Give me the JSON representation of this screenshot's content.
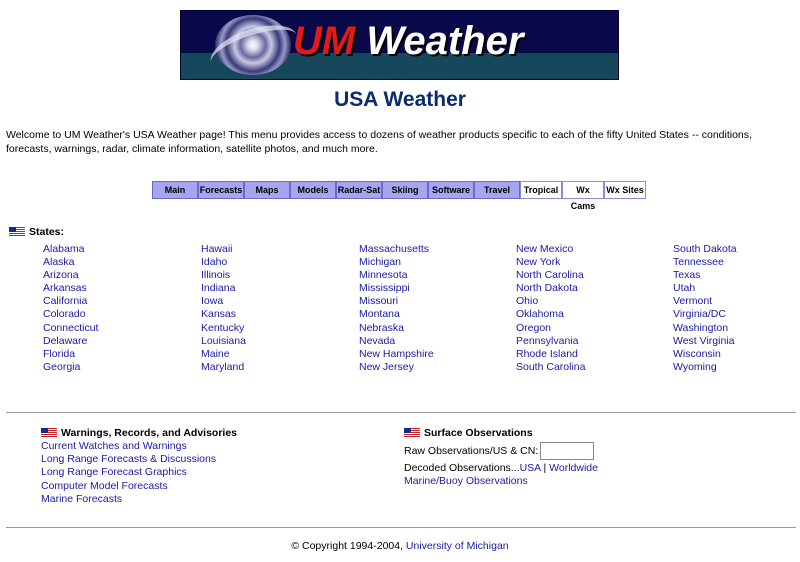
{
  "banner": {
    "brand_um": "UM",
    "brand_weather": "Weather",
    "image": "hurricane-satellite-image"
  },
  "title": "USA Weather",
  "intro": "Welcome to UM Weather's USA Weather page! This menu provides access to dozens of weather products specific to each of the fifty United States -- conditions, forecasts, warnings, radar, climate information, satellite photos, and much more.",
  "nav": [
    {
      "label": "Main",
      "width": 44,
      "style": "active"
    },
    {
      "label": "Forecasts",
      "width": 44,
      "style": "blue"
    },
    {
      "label": "Maps",
      "width": 44,
      "style": "blue"
    },
    {
      "label": "Models",
      "width": 44,
      "style": "blue"
    },
    {
      "label": "Radar-Sat",
      "width": 44,
      "style": "blue"
    },
    {
      "label": "Skiing",
      "width": 44,
      "style": "blue"
    },
    {
      "label": "Software",
      "width": 44,
      "style": "blue"
    },
    {
      "label": "Travel",
      "width": 44,
      "style": "blue"
    },
    {
      "label": "Tropical",
      "width": 40,
      "style": "light"
    },
    {
      "label": "Wx Cams",
      "width": 40,
      "style": "light"
    },
    {
      "label": "Wx Sites",
      "width": 40,
      "style": "light"
    }
  ],
  "states_heading": "States:",
  "states": [
    [
      "Alabama",
      "Alaska",
      "Arizona",
      "Arkansas",
      "California",
      "Colorado",
      "Connecticut",
      "Delaware",
      "Florida",
      "Georgia"
    ],
    [
      "Hawaii",
      "Idaho",
      "Illinois",
      "Indiana",
      "Iowa",
      "Kansas",
      "Kentucky",
      "Louisiana",
      "Maine",
      "Maryland"
    ],
    [
      "Massachusetts",
      "Michigan",
      "Minnesota",
      "Mississippi",
      "Missouri",
      "Montana",
      "Nebraska",
      "Nevada",
      "New Hampshire",
      "New Jersey"
    ],
    [
      "New Mexico",
      "New York",
      "North Carolina",
      "North Dakota",
      "Ohio",
      "Oklahoma",
      "Oregon",
      "Pennsylvania",
      "Rhode Island",
      "South Carolina"
    ],
    [
      "South Dakota",
      "Tennessee",
      "Texas",
      "Utah",
      "Vermont",
      "Virginia/DC",
      "Washington",
      "West Virginia",
      "Wisconsin",
      "Wyoming"
    ]
  ],
  "warnings": {
    "heading": "Warnings, Records, and Advisories",
    "links": [
      "Current Watches and Warnings",
      "Long Range Forecasts & Discussions",
      "Long Range Forecast Graphics",
      "Computer Model Forecasts",
      "Marine Forecasts"
    ]
  },
  "surface": {
    "heading": "Surface Observations",
    "raw_label": "Raw Observations/US & CN:",
    "raw_value": "",
    "decoded_label": "Decoded Observations...",
    "decoded_usa": "USA",
    "decoded_sep": " | ",
    "decoded_world": "Worldwide",
    "marine": "Marine/Buoy Observations"
  },
  "footer": {
    "copyright": "© Copyright 1994-2004, ",
    "link": "University of Michigan"
  },
  "colors": {
    "link": "#1a1aa6",
    "title": "#0c2c6a",
    "nav_blue": "#a6a6f0",
    "banner_bg": "#08084a"
  }
}
